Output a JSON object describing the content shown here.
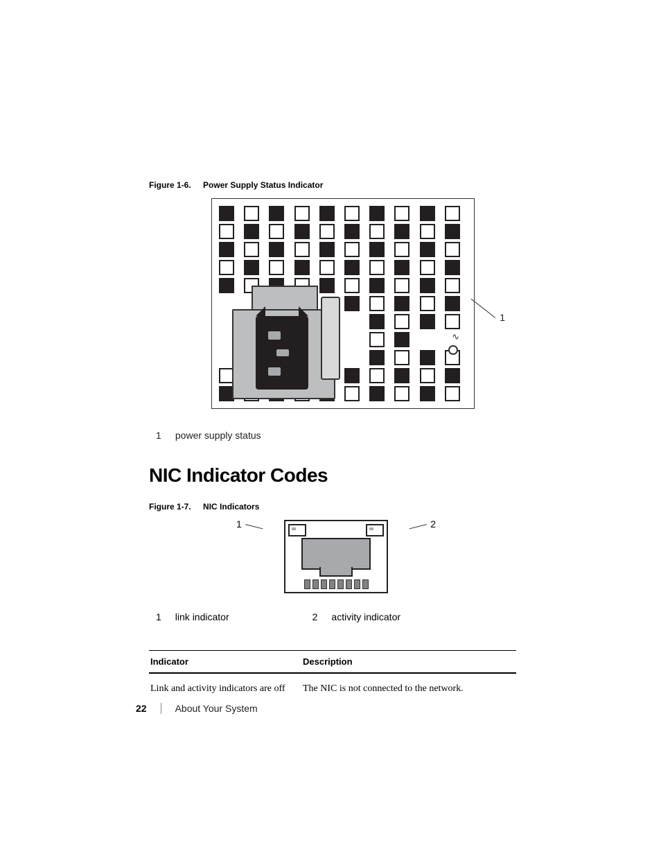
{
  "figure_1_6": {
    "label": "Figure 1-6.",
    "title": "Power Supply Status Indicator",
    "callout": "1"
  },
  "legend_psu": {
    "num": "1",
    "text": "power supply status"
  },
  "section_heading": "NIC Indicator Codes",
  "figure_1_7": {
    "label": "Figure 1-7.",
    "title": "NIC Indicators",
    "callout_left": "1",
    "callout_right": "2"
  },
  "legend_nic": {
    "item1_num": "1",
    "item1_text": "link indicator",
    "item2_num": "2",
    "item2_text": "activity indicator"
  },
  "table": {
    "head_indicator": "Indicator",
    "head_description": "Description",
    "row1_indicator": "Link and activity indicators are off",
    "row1_description": "The NIC is not connected to the network."
  },
  "footer": {
    "page_number": "22",
    "section": "About Your System"
  }
}
